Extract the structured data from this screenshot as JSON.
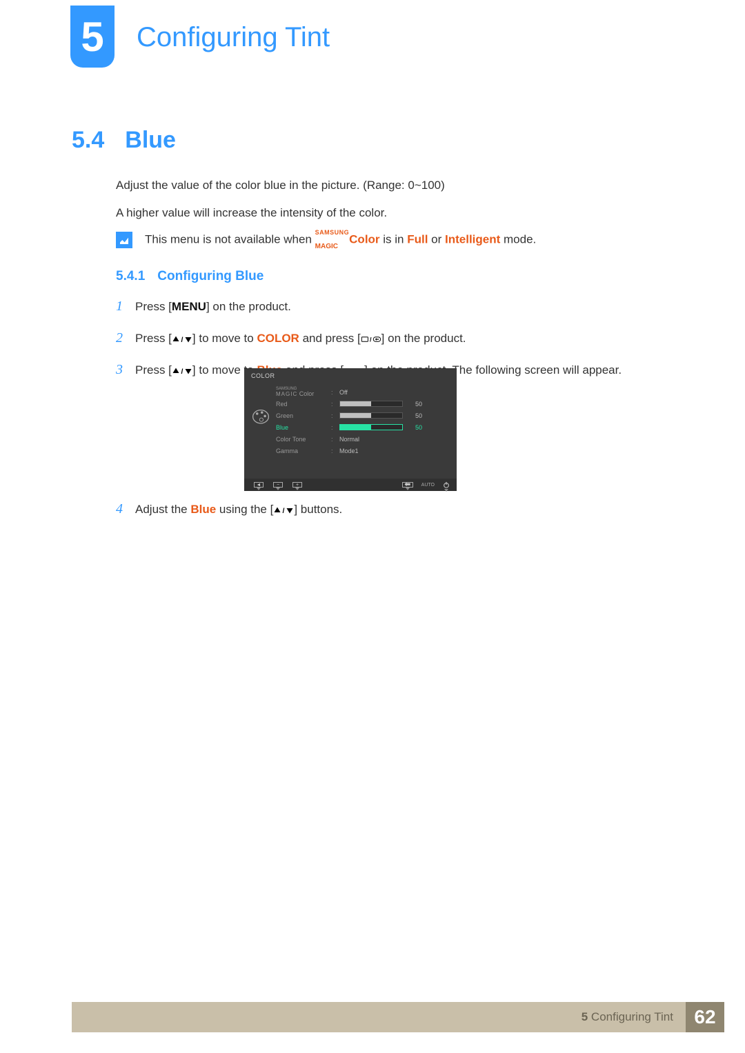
{
  "chapter": {
    "number": "5",
    "title": "Configuring Tint"
  },
  "section": {
    "number": "5.4",
    "name": "Blue"
  },
  "intro": {
    "line1": "Adjust the value of the color blue in the picture. (Range: 0~100)",
    "line2": "A higher value will increase the intensity of the color."
  },
  "note": {
    "prefix": "This menu is not available when ",
    "magic_super": "SAMSUNG",
    "magic_sub": "MAGIC",
    "magic_word": "Color",
    "mid1": " is in ",
    "mode1": "Full",
    "mid2": " or ",
    "mode2": "Intelligent",
    "suffix": " mode."
  },
  "subsection": {
    "number": "5.4.1",
    "name": "Configuring Blue"
  },
  "steps": {
    "s1": {
      "num": "1",
      "t1": "Press [",
      "key": "MENU",
      "t2": "] on the product."
    },
    "s2": {
      "num": "2",
      "t1": "Press [",
      "t2": "] to move to ",
      "kw": "COLOR",
      "t3": " and press [",
      "t4": "] on the product."
    },
    "s3": {
      "num": "3",
      "t1": "Press [",
      "t2": "] to move to ",
      "kw": "Blue",
      "t3": " and press [",
      "t4": "] on the product. The following screen will appear."
    },
    "s4": {
      "num": "4",
      "t1": "Adjust the ",
      "kw": "Blue",
      "t2": " using the [",
      "t3": "] buttons."
    }
  },
  "osd": {
    "title": "COLOR",
    "rows": {
      "magic": {
        "sup": "SAMSUNG",
        "main": "MAGIC",
        "after": "Color",
        "value": "Off"
      },
      "red": {
        "label": "Red",
        "value": "50",
        "fill": 50
      },
      "green": {
        "label": "Green",
        "value": "50",
        "fill": 50
      },
      "blue": {
        "label": "Blue",
        "value": "50",
        "fill": 50
      },
      "colortone": {
        "label": "Color Tone",
        "value": "Normal"
      },
      "gamma": {
        "label": "Gamma",
        "value": "Mode1"
      }
    },
    "footer": {
      "auto": "AUTO"
    }
  },
  "footer": {
    "chapnum": "5",
    "chapter": "Configuring Tint",
    "page": "62"
  }
}
